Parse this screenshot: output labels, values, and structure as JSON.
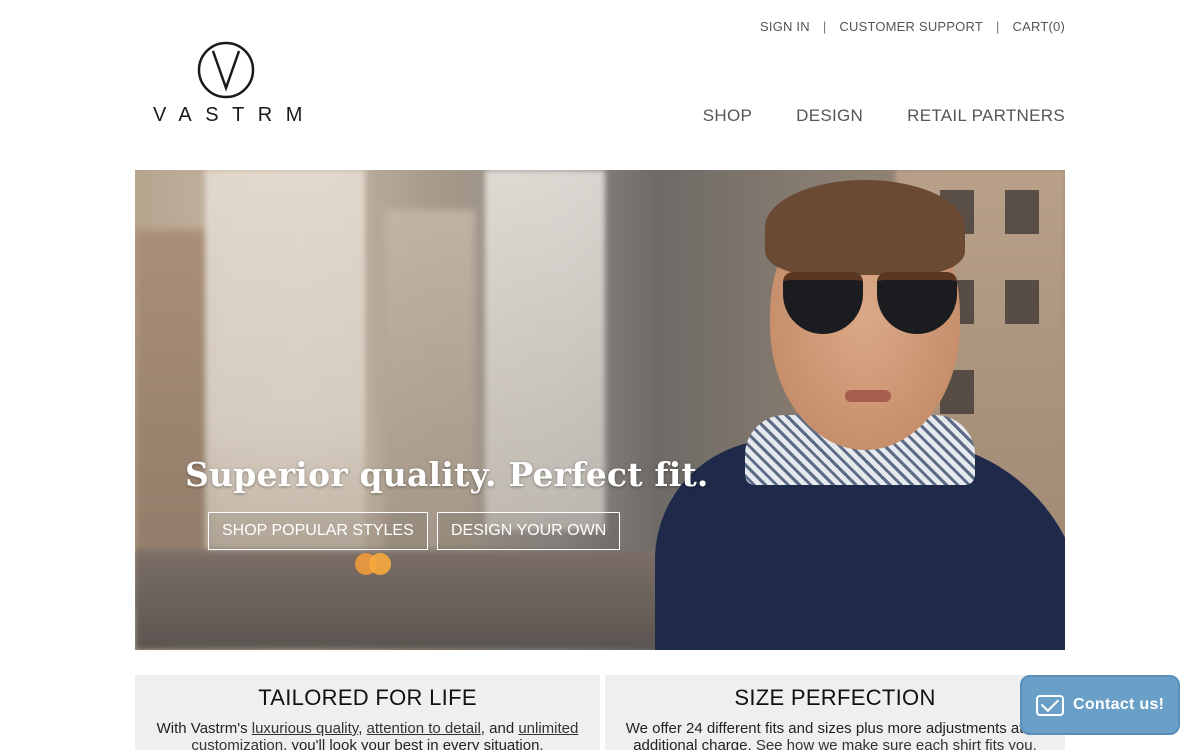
{
  "utility_nav": {
    "sign_in": "SIGN IN",
    "separator": "|",
    "customer_support": "CUSTOMER SUPPORT",
    "cart": "CART(0)"
  },
  "logo": {
    "wordmark": "VASTRM",
    "icon": "v-circle-logo-icon"
  },
  "main_nav": {
    "items": [
      {
        "label": "SHOP"
      },
      {
        "label": "DESIGN"
      },
      {
        "label": "RETAIL PARTNERS"
      }
    ]
  },
  "hero": {
    "headline": "Superior quality. Perfect fit.",
    "buttons": {
      "shop_popular": "SHOP POPULAR STYLES",
      "design_own": "DESIGN YOUR OWN"
    }
  },
  "features": [
    {
      "title": "TAILORED FOR LIFE",
      "text_prefix": "With Vastrm's ",
      "link1": "luxurious quality",
      "sep1": ", ",
      "link2": "attention to detail",
      "sep2": ", and ",
      "link3": "unlimited customization",
      "text_suffix": ", you'll look your best in every situation."
    },
    {
      "title": "SIZE PERFECTION",
      "text": "We offer 24 different fits and sizes plus more adjustments at no additional charge.",
      "link": "See how we make sure each shirt fits you."
    }
  ],
  "contact_widget": {
    "label": "Contact us!",
    "icon": "envelope-icon"
  },
  "colors": {
    "contact_bg": "#6a9fc7",
    "nav_text": "#555555",
    "feature_bg": "#efefef",
    "carousel_dot": "#f09a3c"
  }
}
